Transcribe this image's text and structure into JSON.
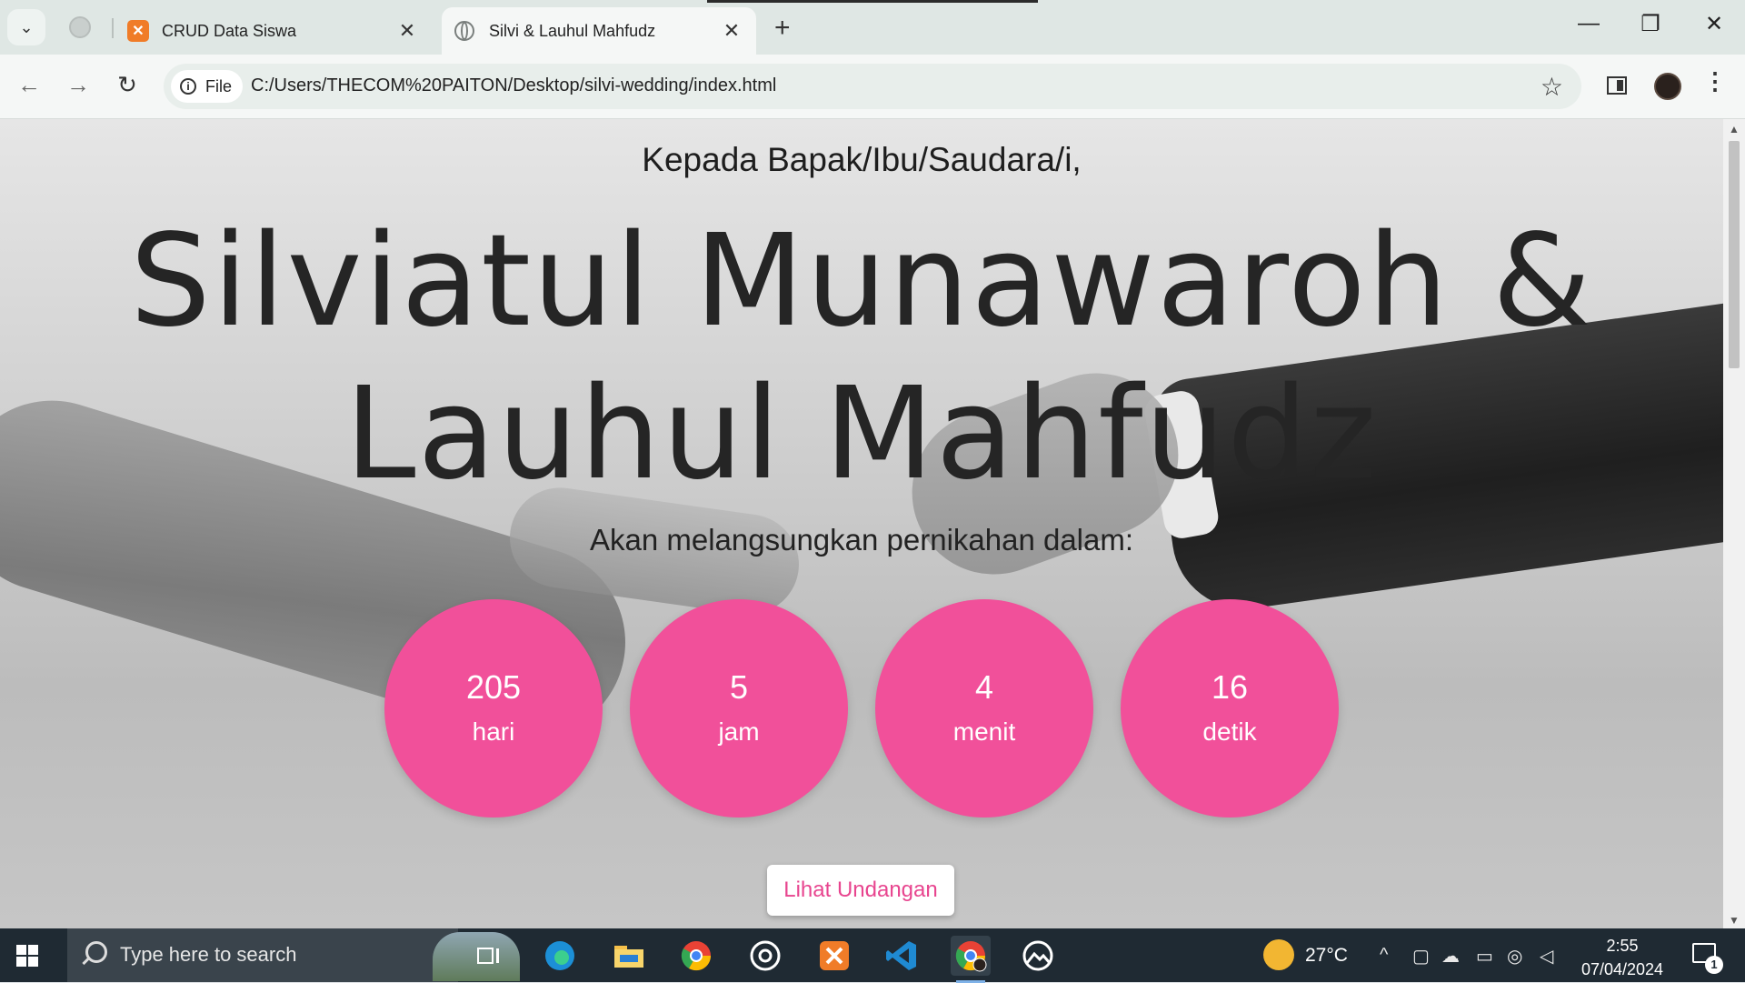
{
  "browser": {
    "tabs": [
      {
        "title": "CRUD Data Siswa",
        "icon": "xampp-icon",
        "active": false
      },
      {
        "title": "Silvi & Lauhul Mahfudz",
        "icon": "globe-icon",
        "active": true
      }
    ],
    "omnibox": {
      "security_chip": "File",
      "url": "C:/Users/THECOM%20PAITON/Desktop/silvi-wedding/index.html"
    }
  },
  "page": {
    "greeting": "Kepada Bapak/Ibu/Saudara/i,",
    "names": "Silviatul Munawaroh & Lauhul Mahfudz",
    "subtitle": "Akan melangsungkan pernikahan dalam:",
    "countdown": [
      {
        "value": "205",
        "unit": "hari"
      },
      {
        "value": "5",
        "unit": "jam"
      },
      {
        "value": "4",
        "unit": "menit"
      },
      {
        "value": "16",
        "unit": "detik"
      }
    ],
    "button": "Lihat Undangan",
    "accent_color": "#f1509a"
  },
  "taskbar": {
    "search_placeholder": "Type here to search",
    "weather": "27°C",
    "time": "2:55",
    "date": "07/04/2024",
    "notification_count": "1",
    "apps": [
      "task-view-icon",
      "edge-icon",
      "file-explorer-icon",
      "chrome-icon",
      "obs-icon",
      "xampp-icon",
      "vscode-icon",
      "chrome-active-icon",
      "photos-icon"
    ]
  }
}
